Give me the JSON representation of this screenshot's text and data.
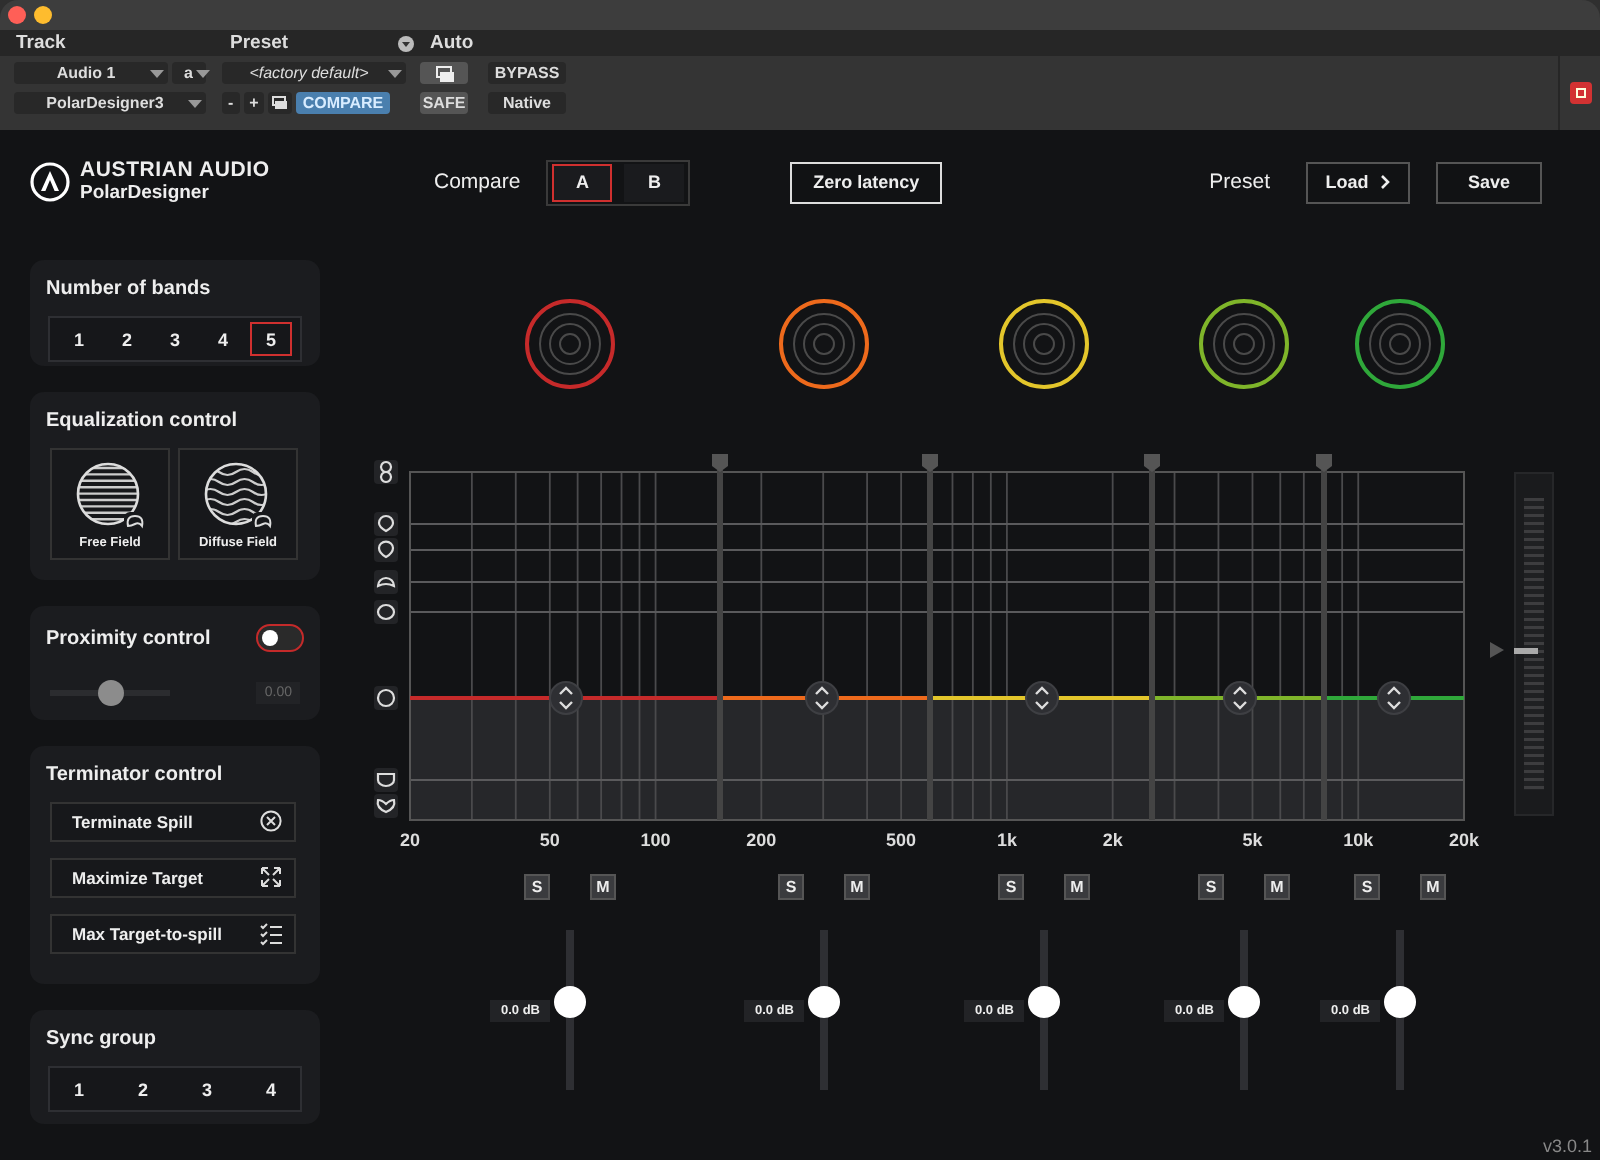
{
  "host": {
    "track_label": "Track",
    "preset_label": "Preset",
    "auto_label": "Auto",
    "track": "Audio 1",
    "track_sub": "a",
    "insert": "PolarDesigner3",
    "preset": "<factory default>",
    "minus": "-",
    "plus": "+",
    "compare": "COMPARE",
    "compare_on": true,
    "safe": "SAFE",
    "bypass": "BYPASS",
    "native": "Native"
  },
  "logo": {
    "brand": "AUSTRIAN AUDIO",
    "product": "PolarDesigner"
  },
  "compare": {
    "label": "Compare",
    "options": [
      {
        "label": "A",
        "selected": true
      },
      {
        "label": "B",
        "selected": false
      }
    ]
  },
  "zero_latency": {
    "label": "Zero latency",
    "on": false
  },
  "preset": {
    "label": "Preset",
    "load": "Load",
    "save": "Save"
  },
  "number_of_bands": {
    "title": "Number of bands",
    "options": [
      {
        "label": "1",
        "selected": false
      },
      {
        "label": "2",
        "selected": false
      },
      {
        "label": "3",
        "selected": false
      },
      {
        "label": "4",
        "selected": false
      },
      {
        "label": "5",
        "selected": true
      }
    ]
  },
  "equalization": {
    "title": "Equalization control",
    "options": [
      {
        "label": "Free Field",
        "kind": "free"
      },
      {
        "label": "Diffuse Field",
        "kind": "diffuse"
      }
    ]
  },
  "proximity": {
    "title": "Proximity control",
    "on": false,
    "level": 0.5,
    "reading": "0.00"
  },
  "terminator": {
    "title": "Terminator control",
    "buttons": [
      {
        "label": "Terminate Spill",
        "kind": "spill"
      },
      {
        "label": "Maximize Target",
        "kind": "target"
      },
      {
        "label": "Max Target-to-spill",
        "kind": "ratio"
      }
    ]
  },
  "sync_group": {
    "title": "Sync group",
    "options": [
      {
        "label": "1",
        "selected": false
      },
      {
        "label": "2",
        "selected": false
      },
      {
        "label": "3",
        "selected": false
      },
      {
        "label": "4",
        "selected": false
      }
    ]
  },
  "bands": [
    {
      "color": "#c62a2a",
      "solo_label": "S",
      "solo": false,
      "mute_label": "M",
      "mute": false,
      "level": 0.55,
      "reading": "0.0 dB"
    },
    {
      "color": "#ee6a1c",
      "solo_label": "S",
      "solo": false,
      "mute_label": "M",
      "mute": false,
      "level": 0.55,
      "reading": "0.0 dB"
    },
    {
      "color": "#e3c62b",
      "solo_label": "S",
      "solo": false,
      "mute_label": "M",
      "mute": false,
      "level": 0.55,
      "reading": "0.0 dB"
    },
    {
      "color": "#7fb52a",
      "solo_label": "S",
      "solo": false,
      "mute_label": "M",
      "mute": false,
      "level": 0.55,
      "reading": "0.0 dB"
    },
    {
      "color": "#2fa83a",
      "solo_label": "S",
      "solo": false,
      "mute_label": "M",
      "mute": false,
      "level": 0.55,
      "reading": "0.0 dB"
    }
  ],
  "frequency_axis": [
    "20",
    "50",
    "100",
    "200",
    "500",
    "1k",
    "2k",
    "5k",
    "10k",
    "20k"
  ],
  "output_slider": {
    "level": 0.48
  },
  "version": "v3.0.1"
}
